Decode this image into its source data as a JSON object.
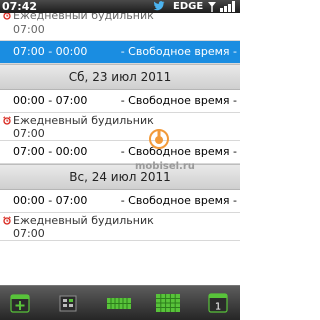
{
  "statusbar": {
    "time": "07:42",
    "network": "EDGE"
  },
  "calendar": {
    "rows": [
      {
        "kind": "alarm",
        "title": "Ежедневный будильник",
        "time": "07:00"
      },
      {
        "kind": "free",
        "range": "07:00 - 00:00",
        "label": "- Свободное время -",
        "selected": true
      },
      {
        "kind": "header",
        "date": "Сб, 23 июл 2011"
      },
      {
        "kind": "free",
        "range": "00:00 - 07:00",
        "label": "- Свободное время -"
      },
      {
        "kind": "alarm",
        "title": "Ежедневный будильник",
        "time": "07:00"
      },
      {
        "kind": "free",
        "range": "07:00 - 00:00",
        "label": "- Свободное время -"
      },
      {
        "kind": "header",
        "date": "Вс, 24 июл 2011"
      },
      {
        "kind": "free",
        "range": "00:00 - 07:00",
        "label": "- Свободное время -"
      },
      {
        "kind": "alarm",
        "title": "Ежедневный будильник",
        "time": "07:00"
      }
    ]
  },
  "watermark": {
    "text": "mobisel.ru"
  },
  "toolbar": {
    "buttons": [
      "new-event-icon",
      "day-view-icon",
      "week-view-icon",
      "month-view-icon",
      "today-icon"
    ],
    "today_day": "1"
  },
  "colors": {
    "selection": "#1a8de1",
    "alarm_icon": "#d9261c",
    "toolbar_green": "#58c33a"
  }
}
